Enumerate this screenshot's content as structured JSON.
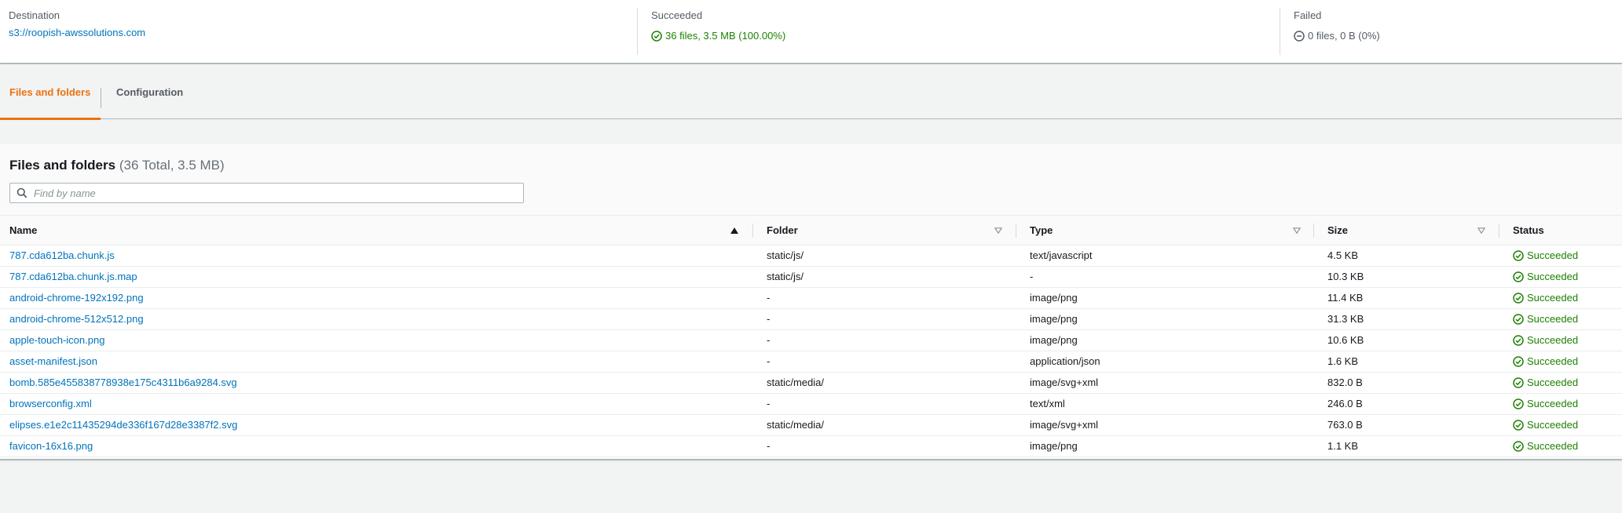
{
  "summary": {
    "destination": {
      "label": "Destination",
      "value": "s3://roopish-awssolutions.com"
    },
    "succeeded": {
      "label": "Succeeded",
      "value": "36 files, 3.5 MB (100.00%)"
    },
    "failed": {
      "label": "Failed",
      "value": "0 files, 0 B (0%)"
    }
  },
  "tabs": [
    {
      "label": "Files and folders",
      "active": true
    },
    {
      "label": "Configuration",
      "active": false
    }
  ],
  "files": {
    "title": "Files and folders",
    "counter": "(36 Total, 3.5 MB)",
    "search_placeholder": "Find by name",
    "columns": [
      "Name",
      "Folder",
      "Type",
      "Size",
      "Status"
    ],
    "rows": [
      {
        "name": "787.cda612ba.chunk.js",
        "folder": "static/js/",
        "type": "text/javascript",
        "size": "4.5 KB",
        "status": "Succeeded"
      },
      {
        "name": "787.cda612ba.chunk.js.map",
        "folder": "static/js/",
        "type": "-",
        "size": "10.3 KB",
        "status": "Succeeded"
      },
      {
        "name": "android-chrome-192x192.png",
        "folder": "-",
        "type": "image/png",
        "size": "11.4 KB",
        "status": "Succeeded"
      },
      {
        "name": "android-chrome-512x512.png",
        "folder": "-",
        "type": "image/png",
        "size": "31.3 KB",
        "status": "Succeeded"
      },
      {
        "name": "apple-touch-icon.png",
        "folder": "-",
        "type": "image/png",
        "size": "10.6 KB",
        "status": "Succeeded"
      },
      {
        "name": "asset-manifest.json",
        "folder": "-",
        "type": "application/json",
        "size": "1.6 KB",
        "status": "Succeeded"
      },
      {
        "name": "bomb.585e455838778938e175c4311b6a9284.svg",
        "folder": "static/media/",
        "type": "image/svg+xml",
        "size": "832.0 B",
        "status": "Succeeded"
      },
      {
        "name": "browserconfig.xml",
        "folder": "-",
        "type": "text/xml",
        "size": "246.0 B",
        "status": "Succeeded"
      },
      {
        "name": "elipses.e1e2c11435294de336f167d28e3387f2.svg",
        "folder": "static/media/",
        "type": "image/svg+xml",
        "size": "763.0 B",
        "status": "Succeeded"
      },
      {
        "name": "favicon-16x16.png",
        "folder": "-",
        "type": "image/png",
        "size": "1.1 KB",
        "status": "Succeeded"
      }
    ]
  },
  "colors": {
    "accent": "#ec7211",
    "link": "#0073bb",
    "success": "#1d8102"
  },
  "icons": {
    "success": "check-circle-icon",
    "failed": "minus-circle-icon",
    "search": "search-icon",
    "sort_asc": "sort-ascending-icon",
    "sort": "sort-icon"
  }
}
